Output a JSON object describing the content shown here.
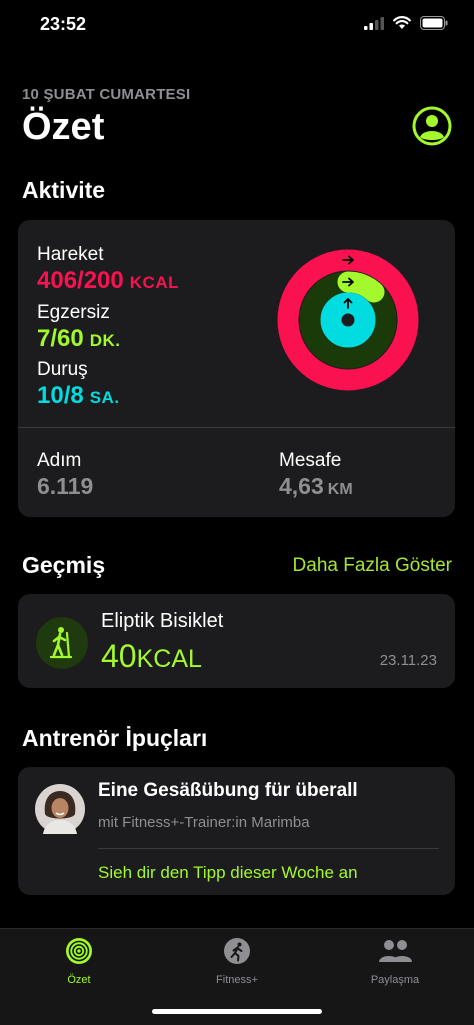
{
  "status": {
    "time": "23:52"
  },
  "header": {
    "date": "10 ŞUBAT CUMARTESI",
    "title": "Özet"
  },
  "activity": {
    "section_title": "Aktivite",
    "move": {
      "label": "Hareket",
      "value": "406/200",
      "unit": "KCAL",
      "progress": 2.03
    },
    "exercise": {
      "label": "Egzersiz",
      "value": "7/60",
      "unit": "DK.",
      "progress": 0.117
    },
    "stand": {
      "label": "Duruş",
      "value": "10/8",
      "unit": "SA.",
      "progress": 1.25
    },
    "steps": {
      "label": "Adım",
      "value": "6.119"
    },
    "distance": {
      "label": "Mesafe",
      "value": "4,63",
      "unit": "KM"
    },
    "colors": {
      "move": "#fa114f",
      "exercise": "#a3f92b",
      "stand": "#00dcdf"
    }
  },
  "history": {
    "section_title": "Geçmiş",
    "see_more": "Daha Fazla Göster",
    "workout": {
      "name": "Eliptik Bisiklet",
      "value": "40",
      "unit": "KCAL",
      "date": "23.11.23"
    }
  },
  "tips": {
    "section_title": "Antrenör İpuçları",
    "title": "Eine Gesäßübung für überall",
    "subtitle": "mit Fitness+-Trainer:in Marimba",
    "link": "Sieh dir den Tipp dieser Woche an"
  },
  "tabs": [
    {
      "label": "Özet",
      "icon": "rings-icon",
      "active": true
    },
    {
      "label": "Fitness+",
      "icon": "runner-icon",
      "active": false
    },
    {
      "label": "Paylaşma",
      "icon": "people-icon",
      "active": false
    }
  ]
}
